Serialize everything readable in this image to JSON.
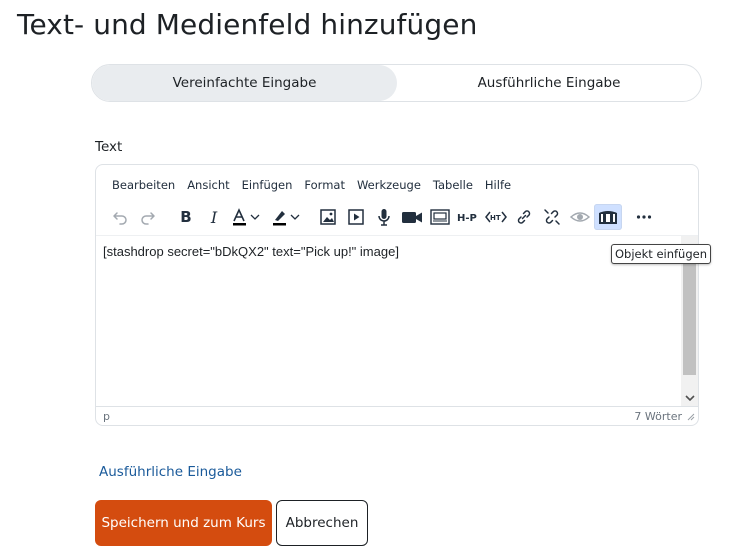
{
  "page": {
    "title": "Text- und Medienfeld hinzufügen"
  },
  "mode_switch": {
    "simple": "Vereinfachte Eingabe",
    "advanced": "Ausführliche Eingabe",
    "selected": "simple"
  },
  "field": {
    "label": "Text"
  },
  "editor": {
    "menu": [
      "Bearbeiten",
      "Ansicht",
      "Einfügen",
      "Format",
      "Werkzeuge",
      "Tabelle",
      "Hilfe"
    ],
    "toolbar_icons": [
      "undo-icon",
      "redo-icon",
      "bold-icon",
      "italic-icon",
      "text-color-icon",
      "highlight-color-icon",
      "image-icon",
      "media-icon",
      "record-audio-icon",
      "record-video-icon",
      "manage-files-icon",
      "h5p-icon",
      "html-icon",
      "link-icon",
      "unlink-icon",
      "accessibility-eye-icon",
      "stash-object-icon",
      "more-icon"
    ],
    "bold_glyph": "B",
    "italic_glyph": "I",
    "content": "[stashdrop secret=\"bDkQX2\" text=\"Pick up!\" image]",
    "status_path": "p",
    "word_count": "7 Wörter",
    "tooltip": "Objekt einfügen"
  },
  "links": {
    "advanced_input": "Ausführliche Eingabe"
  },
  "actions": {
    "save": "Speichern und zum Kurs",
    "cancel": "Abbrechen"
  },
  "colors": {
    "primary": "#d44c0f",
    "link": "#1a5a9a",
    "selected_tab_bg": "#e9ecef"
  }
}
